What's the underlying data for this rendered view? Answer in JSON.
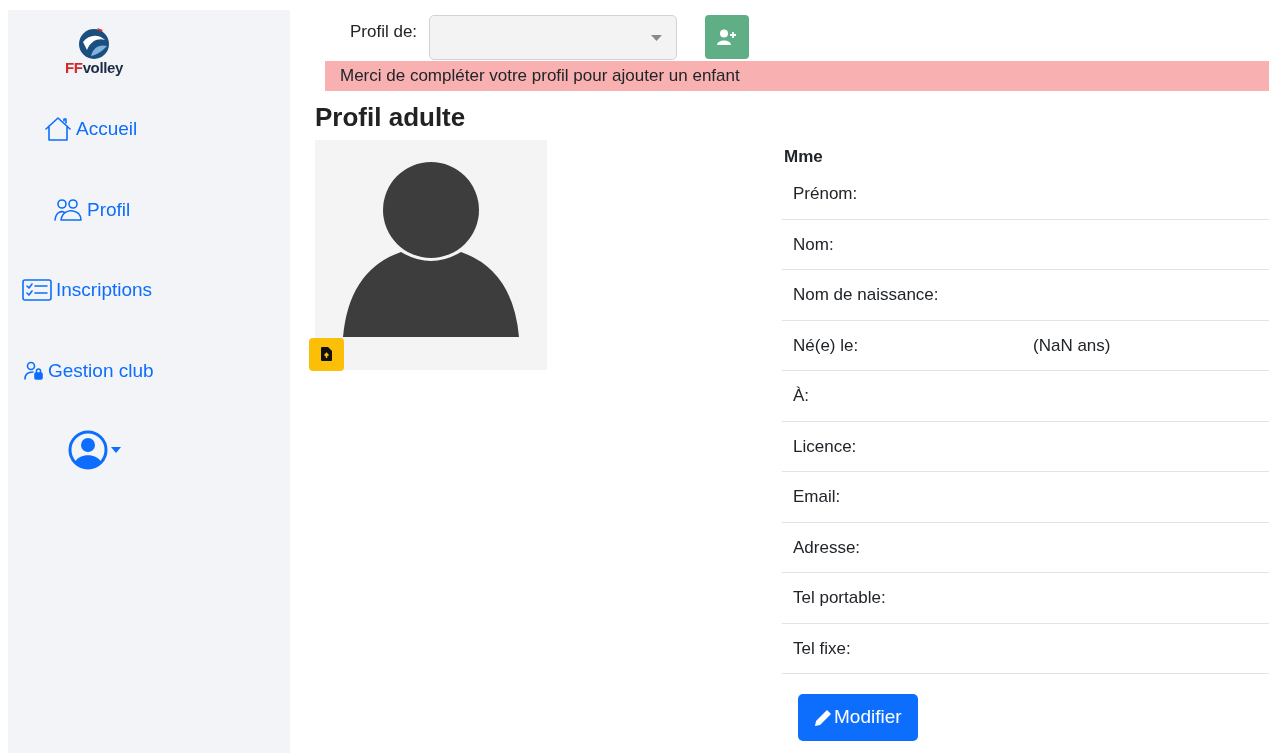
{
  "sidebar": {
    "logo": {
      "prefix": "FF",
      "name": "volley"
    },
    "items": [
      {
        "label": "Accueil",
        "kind": "home"
      },
      {
        "label": "Profil",
        "kind": "people"
      },
      {
        "label": "Inscriptions",
        "kind": "list"
      },
      {
        "label": "Gestion club",
        "kind": "admin"
      }
    ]
  },
  "profile_selector": {
    "label": "Profil de:"
  },
  "alert": "Merci de compléter votre profil pour ajouter un enfant",
  "title": "Profil adulte",
  "civility": "Mme",
  "fields": [
    {
      "label": "Prénom:"
    },
    {
      "label": "Nom:"
    },
    {
      "label": "Nom de naissance:"
    },
    {
      "label": "Né(e) le:",
      "value": "(NaN ans)"
    },
    {
      "label": "À:"
    },
    {
      "label": "Licence:"
    },
    {
      "label": "Email:"
    },
    {
      "label": "Adresse:"
    },
    {
      "label": "Tel portable:"
    },
    {
      "label": "Tel fixe:"
    }
  ],
  "edit_button": "Modifier"
}
